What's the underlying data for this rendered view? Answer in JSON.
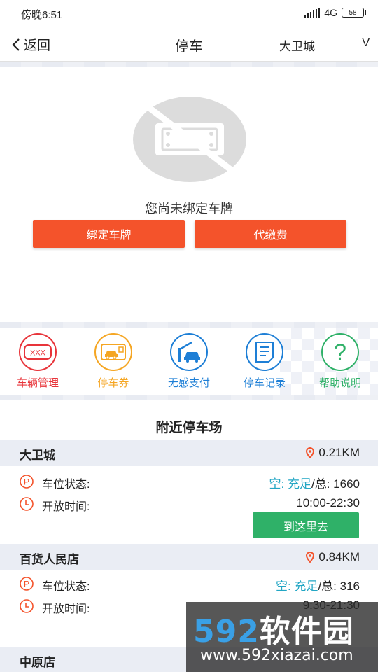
{
  "status_bar": {
    "time": "傍晚6:51",
    "network": "4G",
    "battery": "58"
  },
  "nav": {
    "back_label": "返回",
    "title": "停车",
    "city": "大卫城",
    "city_chevron": "V"
  },
  "plate": {
    "message": "您尚未绑定车牌",
    "bind_button": "绑定车牌",
    "pay_button": "代缴费"
  },
  "features": [
    {
      "label": "车辆管理",
      "color": "#e8343a",
      "icon": "plate-icon",
      "icon_text": "XXX"
    },
    {
      "label": "停车券",
      "color": "#f5a623",
      "icon": "ticket-car-icon"
    },
    {
      "label": "无感支付",
      "color": "#1e7fd6",
      "icon": "gate-car-icon"
    },
    {
      "label": "停车记录",
      "color": "#1e7fd6",
      "icon": "document-icon"
    },
    {
      "label": "帮助说明",
      "color": "#2fb168",
      "icon": "question-icon",
      "icon_text": "?"
    }
  ],
  "section_title": "附近停车场",
  "lots": [
    {
      "name": "大卫城",
      "distance": "0.21KM",
      "status_label": "车位状态:",
      "status_value_cyan": "空: 充足",
      "status_value_rest": "/总: 1660",
      "hours_label": "开放时间:",
      "hours_value": "10:00-22:30",
      "go_button": "到这里去"
    },
    {
      "name": "百货人民店",
      "distance": "0.84KM",
      "status_label": "车位状态:",
      "status_value_cyan": "空: 充足",
      "status_value_rest": "/总: 316",
      "hours_label": "开放时间:",
      "hours_value": "9:30-21:30"
    },
    {
      "name": "中原店"
    }
  ],
  "watermark": {
    "brand_digits": "592",
    "brand_text": "软件园",
    "url": "www.592xiazai.com"
  },
  "colors": {
    "accent_red": "#f4532b",
    "green": "#2fb168",
    "cyan": "#22a6c4",
    "pin": "#f4532b"
  }
}
